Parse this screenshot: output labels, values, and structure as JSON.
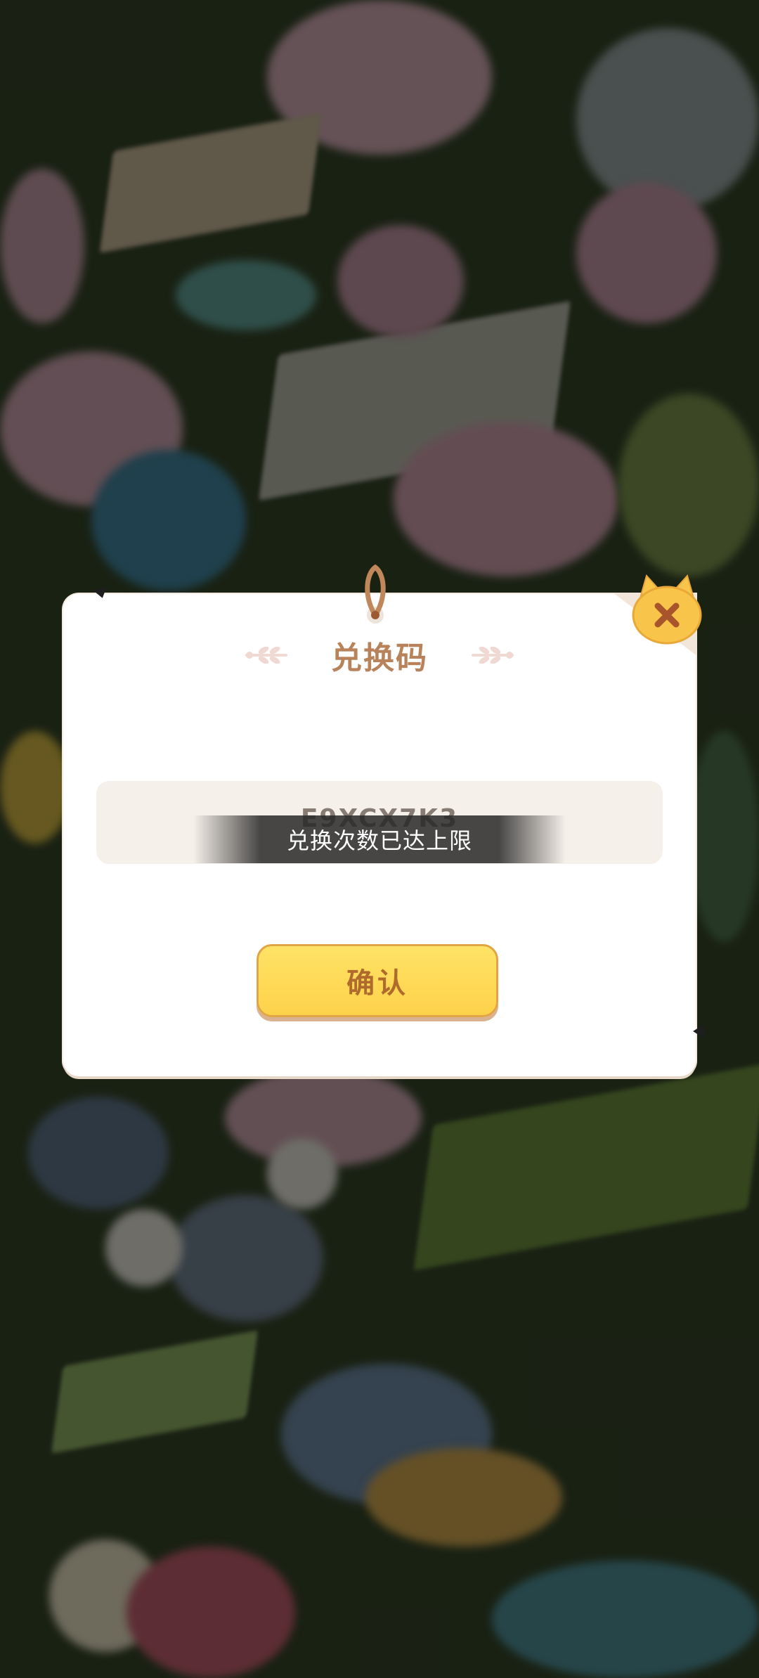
{
  "dialog": {
    "title": "兑换码",
    "code_value": "E9XCX7K3",
    "confirm_label": "确认"
  },
  "toast": {
    "message": "兑换次数已达上限"
  },
  "colors": {
    "title": "#b8825a",
    "button_fill": "#fdd24a",
    "button_text": "#b06a2c",
    "field_bg": "#f6f0ea",
    "close_badge": "#f8c44a"
  },
  "icons": {
    "close": "close-icon",
    "hanger": "rope-hanger-icon",
    "sprig_left": "sprig-left-icon",
    "sprig_right": "sprig-right-icon"
  }
}
